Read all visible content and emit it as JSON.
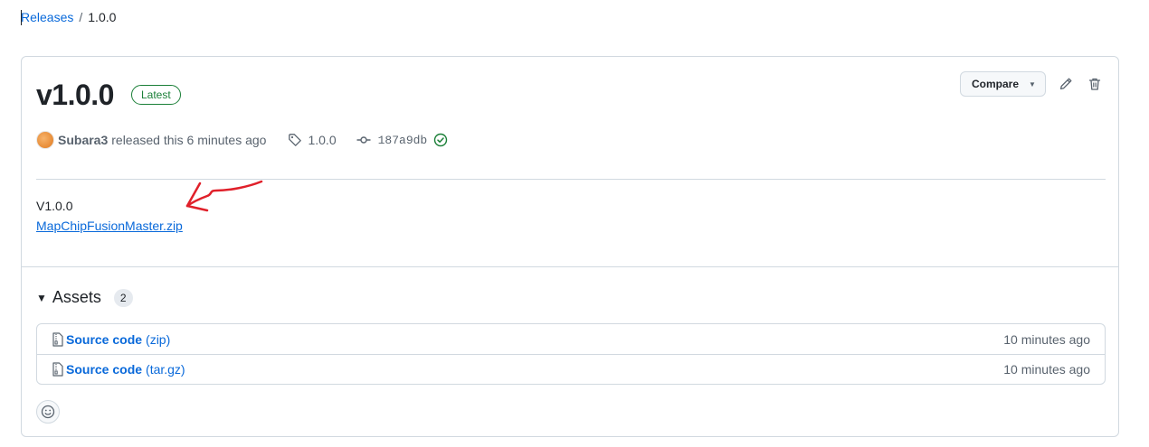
{
  "breadcrumb": {
    "releases_link": "Releases",
    "separator": "/",
    "current": "1.0.0"
  },
  "release": {
    "title": "v1.0.0",
    "badge": "Latest",
    "compare_label": "Compare",
    "author": "Subara3",
    "released_text": "released this 6 minutes ago",
    "tag": "1.0.0",
    "commit": "187a9db",
    "body_version": "V1.0.0",
    "body_link": "MapChipFusionMaster.zip"
  },
  "assets": {
    "heading": "Assets",
    "count": "2",
    "items": [
      {
        "name": "Source code",
        "ext": "(zip)",
        "time": "10 minutes ago"
      },
      {
        "name": "Source code",
        "ext": "(tar.gz)",
        "time": "10 minutes ago"
      }
    ]
  },
  "colors": {
    "link": "#0969da",
    "success": "#1a7f37",
    "annotation": "#e0202a"
  },
  "icons": [
    "tag-icon",
    "commit-icon",
    "verified-check-icon",
    "pencil-icon",
    "trash-icon",
    "file-zip-icon",
    "smiley-icon"
  ]
}
